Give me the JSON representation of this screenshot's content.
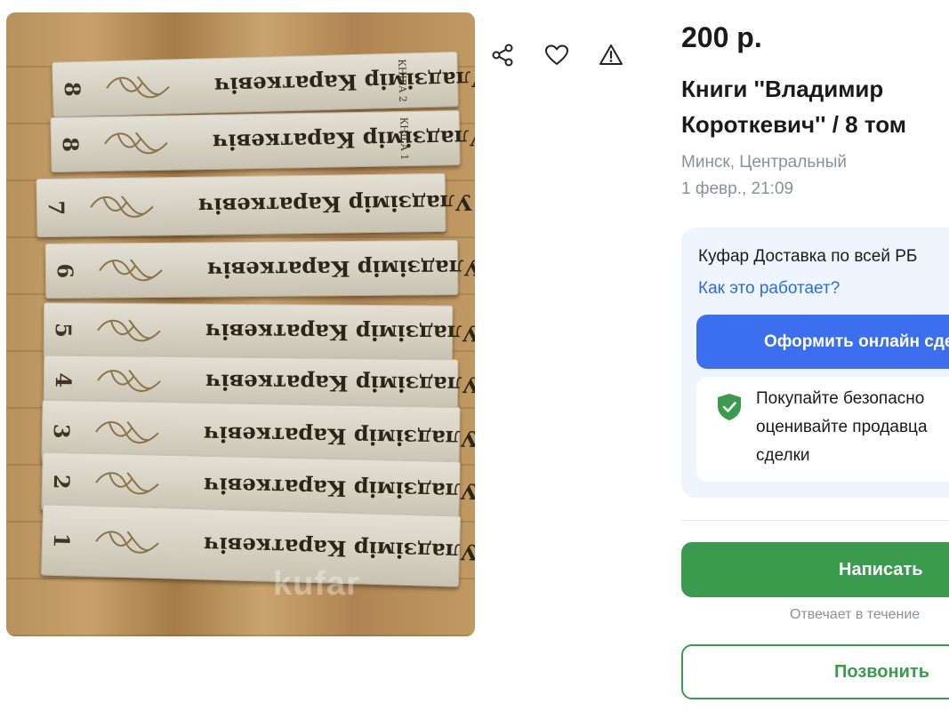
{
  "listing": {
    "price": "200 р.",
    "title_line1": "Книги ''Владимир",
    "title_line2": "Короткевич'' / 8 том",
    "location": "Минск, Центральный",
    "date": "1 февр., 21:09"
  },
  "photo": {
    "watermark": "kufar",
    "books": [
      {
        "number": "8",
        "title": "Уладзімір Караткевіч",
        "volume": "КНІГА 2"
      },
      {
        "number": "8",
        "title": "Уладзімір Караткевіч",
        "volume": "КНІГА 1"
      },
      {
        "number": "7",
        "title": "Уладзімір Караткевіч",
        "volume": ""
      },
      {
        "number": "6",
        "title": "Уладзімір Караткевіч",
        "volume": ""
      },
      {
        "number": "5",
        "title": "Уладзімір Караткевіч",
        "volume": ""
      },
      {
        "number": "4",
        "title": "Уладзімір Караткевіч",
        "volume": ""
      },
      {
        "number": "3",
        "title": "Уладзімір Караткевіч",
        "volume": ""
      },
      {
        "number": "2",
        "title": "Уладзімір Караткевіч",
        "volume": ""
      },
      {
        "number": "1",
        "title": "Уладзімір Караткевіч",
        "volume": ""
      }
    ]
  },
  "actions": {
    "share_icon": "share-icon",
    "favorite_icon": "heart-icon",
    "report_icon": "warning-icon"
  },
  "delivery": {
    "text": "Куфар Доставка по всей РБ",
    "link": "Как это работает?",
    "order_button": "Оформить онлайн сделку",
    "safe_line1": "Покупайте безопасно",
    "safe_line2": "оценивайте продавца",
    "safe_line3": "сделки"
  },
  "contact": {
    "write_button": "Написать",
    "reply_note": "Отвечает в течение",
    "call_button": "Позвонить"
  },
  "colors": {
    "accent_blue": "#3b6ff0",
    "link_blue": "#2c6bdc",
    "accent_green": "#3a9b4f",
    "delivery_bg": "#eef5fe",
    "muted_text": "#8a8f98"
  }
}
